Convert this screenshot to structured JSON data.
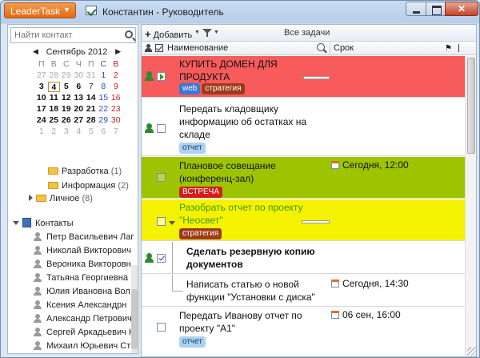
{
  "app": {
    "menu_button": "LeaderTask",
    "window_title": "Константин - Руководитель",
    "close_symbol": "✕"
  },
  "sidebar": {
    "search_placeholder": "Найти контакт",
    "calendar": {
      "month": "Сентябрь 2012",
      "prev": "◀",
      "next": "▶",
      "dow": [
        "П",
        "В",
        "С",
        "Ч",
        "П",
        "С",
        "В"
      ],
      "days": [
        [
          "27",
          "28",
          "29",
          "30",
          "31",
          "1",
          "2"
        ],
        [
          "3",
          "4",
          "5",
          "6",
          "7",
          "8",
          "9"
        ],
        [
          "10",
          "11",
          "12",
          "13",
          "14",
          "15",
          "16"
        ],
        [
          "17",
          "18",
          "19",
          "20",
          "21",
          "22",
          "23"
        ],
        [
          "24",
          "25",
          "26",
          "27",
          "28",
          "29",
          "30"
        ],
        [
          "1",
          "2",
          "3",
          "4",
          "5",
          "6",
          "7"
        ]
      ]
    },
    "folders": [
      {
        "label": "Разработка",
        "count": "(1)"
      },
      {
        "label": "Информация",
        "count": "(2)"
      },
      {
        "label": "Личное",
        "count": "(8)"
      }
    ],
    "contacts_label": "Контакты",
    "contacts": [
      "Петр Васильевич Лаг",
      "Николай Викторович",
      "Вероника Викторовн",
      "Татьяна Георгиевна",
      "Юлия Ивановна Вол",
      "Ксения Александрн",
      "Александр Петрович",
      "Сергей Аркадьевич К",
      "Михаил Юрьевич Ст"
    ]
  },
  "toolbar": {
    "add_label": "Добавить",
    "add_symbol": "+",
    "view_label": "Все задачи"
  },
  "columns": {
    "name": "Наименование",
    "due": "Срок"
  },
  "tasks": [
    {
      "title": "КУПИТЬ ДОМЕН ДЛЯ ПРОДУКТА",
      "tags": [
        "web",
        "стратегия"
      ],
      "due": ""
    },
    {
      "title": "Передать кладовщику информацию об остатках на складе",
      "tags": [
        "отчет"
      ],
      "due": ""
    },
    {
      "title": "Плановое совещание (конференц-зал)",
      "tags": [
        "ВСТРЕЧА"
      ],
      "due": "Сегодня, 12:00"
    },
    {
      "title": "Разобрать отчет по проекту \"Неосвет\"",
      "tags": [
        "стратегия"
      ],
      "due": ""
    },
    {
      "title": "Сделать резервную копию документов",
      "tags": [],
      "due": ""
    },
    {
      "title": "Написать статью о новой функции \"Установки с диска\"",
      "tags": [],
      "due": "Сегодня, 14:30"
    },
    {
      "title": "Передать Иванову отчет по проекту \"А1\"",
      "tags": [
        "отчет"
      ],
      "due": "06 сен, 16:00"
    }
  ],
  "colors": {
    "urgent_row": "#f75b5b",
    "meeting_row": "#9cc400",
    "review_row": "#f5f200",
    "accent": "#e16a14"
  }
}
